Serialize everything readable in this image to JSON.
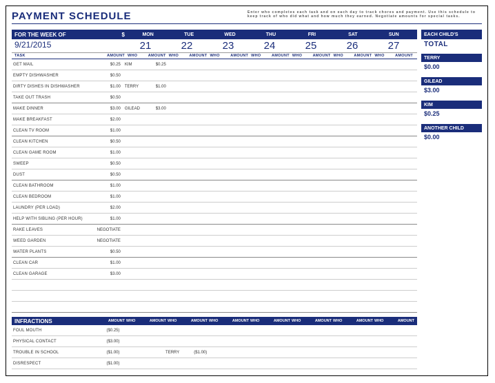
{
  "title": "PAYMENT SCHEDULE",
  "instructions": "Enter who completes each task and on each day to track chores and payment. Use this schedule to keep track of who did what and how much they earned. Negotiate amounts for special tasks.",
  "week": {
    "label": "FOR THE WEEK OF",
    "dollar": "$",
    "date": "9/21/2015",
    "days": [
      "MON",
      "TUE",
      "WED",
      "THU",
      "FRI",
      "SAT",
      "SUN"
    ],
    "nums": [
      "21",
      "22",
      "23",
      "24",
      "25",
      "26",
      "27"
    ]
  },
  "colHeaders": {
    "task": "TASK",
    "amount": "AMOUNT",
    "who": "WHO",
    "damt": "AMOUNT"
  },
  "tasks": [
    {
      "name": "GET MAIL",
      "amount": "$0.25",
      "mon_who": "KIM",
      "mon_amt": "$0.25"
    },
    {
      "name": "EMPTY DISHWASHER",
      "amount": "$0.50"
    },
    {
      "name": "DIRTY DISHES IN DISHWASHER",
      "amount": "$1.00",
      "mon_who": "TERRY",
      "mon_amt": "$1.00"
    },
    {
      "name": "TAKE OUT TRASH",
      "amount": "$0.50",
      "break": true
    },
    {
      "name": "MAKE DINNER",
      "amount": "$3.00",
      "mon_who": "GILEAD",
      "mon_amt": "$3.00"
    },
    {
      "name": "MAKE BREAKFAST",
      "amount": "$2.00"
    },
    {
      "name": "CLEAN TV ROOM",
      "amount": "$1.00",
      "break": true
    },
    {
      "name": "CLEAN KITCHEN",
      "amount": "$0.50"
    },
    {
      "name": "CLEAN GAME ROOM",
      "amount": "$1.00"
    },
    {
      "name": "SWEEP",
      "amount": "$0.50"
    },
    {
      "name": "DUST",
      "amount": "$0.50",
      "break": true
    },
    {
      "name": "CLEAN BATHROOM",
      "amount": "$1.00"
    },
    {
      "name": "CLEAN BEDROOM",
      "amount": "$1.00"
    },
    {
      "name": "LAUNDRY (PER LOAD)",
      "amount": "$2.00"
    },
    {
      "name": "HELP WITH SIBLING (PER HOUR)",
      "amount": "$1.00",
      "break": true
    },
    {
      "name": "RAKE LEAVES",
      "amount": "NEGOTIATE"
    },
    {
      "name": "WEED GARDEN",
      "amount": "NEGOTIATE"
    },
    {
      "name": "WATER PLANTS",
      "amount": "$0.50",
      "break": true
    },
    {
      "name": "CLEAN CAR",
      "amount": "$1.00"
    },
    {
      "name": "CLEAN GARAGE",
      "amount": "$3.00"
    },
    {
      "name": "",
      "amount": ""
    },
    {
      "name": "",
      "amount": ""
    },
    {
      "name": "",
      "amount": "",
      "break": true
    }
  ],
  "infractionsLabel": "INFRACTIONS",
  "infractions": [
    {
      "name": "FOUL MOUTH",
      "amount": "($0.25)"
    },
    {
      "name": "PHYSICAL CONTACT",
      "amount": "($3.00)"
    },
    {
      "name": "TROUBLE IN SCHOOL",
      "amount": "($1.00)",
      "tue_who": "TERRY",
      "tue_amt": "($1.00)"
    },
    {
      "name": "DISRESPECT",
      "amount": "($1.00)"
    },
    {
      "name": "",
      "amount": ""
    }
  ],
  "sidebar": {
    "header": "EACH CHILD'S",
    "totalLabel": "TOTAL",
    "children": [
      {
        "name": "TERRY",
        "total": "$0.00"
      },
      {
        "name": "GILEAD",
        "total": "$3.00"
      },
      {
        "name": "KIM",
        "total": "$0.25"
      },
      {
        "name": "ANOTHER CHILD",
        "total": "$0.00"
      }
    ]
  }
}
